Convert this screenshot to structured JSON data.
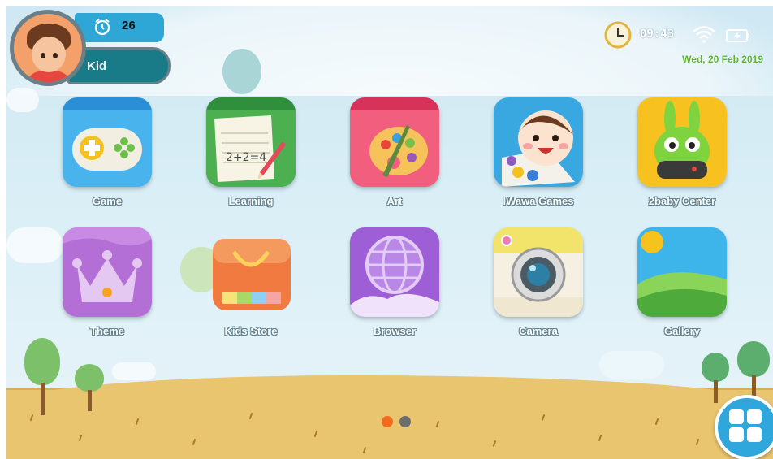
{
  "profile": {
    "timer_count": "26",
    "name": "Kid"
  },
  "status": {
    "time": "09:43",
    "date": "Wed, 20 Feb 2019"
  },
  "apps": [
    {
      "label": "Game",
      "icon": "game-folder-icon"
    },
    {
      "label": "Learning",
      "icon": "learning-folder-icon"
    },
    {
      "label": "Art",
      "icon": "art-folder-icon"
    },
    {
      "label": "IWawa Games",
      "icon": "iwawa-games-icon"
    },
    {
      "label": "2baby Center",
      "icon": "2baby-center-icon"
    },
    {
      "label": "Theme",
      "icon": "theme-crown-icon"
    },
    {
      "label": "Kids Store",
      "icon": "kids-store-icon"
    },
    {
      "label": "Browser",
      "icon": "browser-globe-icon"
    },
    {
      "label": "Camera",
      "icon": "camera-icon"
    },
    {
      "label": "Gallery",
      "icon": "gallery-icon"
    }
  ],
  "pager": {
    "active_color": "#f26a1b",
    "inactive_color": "#6d6d6d"
  },
  "colors": {
    "profile_top_bar": "#2ea7d6",
    "profile_bottom_bar": "#1a7b88",
    "date_text": "#5db52f",
    "apps_button": "#2fa6dc"
  }
}
